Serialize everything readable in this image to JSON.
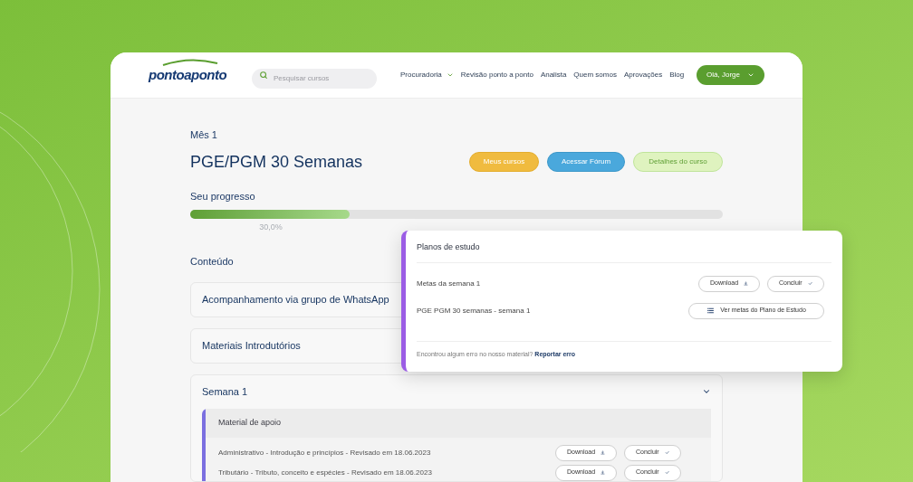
{
  "header": {
    "logo": "pontoaponto",
    "search": {
      "placeholder": "Pesquisar cursos"
    },
    "nav": [
      {
        "label": "Procuradoria",
        "dropdown": true
      },
      {
        "label": "Revisão ponto a ponto",
        "dropdown": false
      },
      {
        "label": "Analista",
        "dropdown": false
      },
      {
        "label": "Quem somos",
        "dropdown": false
      },
      {
        "label": "Aprovações",
        "dropdown": false
      },
      {
        "label": "Blog",
        "dropdown": false
      }
    ],
    "user_button": "Olá, Jorge"
  },
  "course": {
    "month": "Mês 1",
    "title": "PGE/PGM 30 Semanas",
    "buttons": [
      {
        "label": "Meus cursos",
        "kind": "primary"
      },
      {
        "label": "Acessar Fórum",
        "kind": "info"
      },
      {
        "label": "Detalhes do curso",
        "kind": "secondary"
      }
    ]
  },
  "progress": {
    "label": "Seu progresso",
    "level": 0.3,
    "reading": "30,0%"
  },
  "content": {
    "heading": "Conteúdo",
    "sections": [
      {
        "title": "Acompanhamento via grupo de WhatsApp"
      },
      {
        "title": "Materiais Introdutórios"
      },
      {
        "title": "Semana 1",
        "expanded": true,
        "groups": [
          {
            "title": "Material de apoio",
            "items": [
              {
                "title": "Administrativo - Introdução e princípios - Revisado em 18.06.2023",
                "actions": [
                  {
                    "label": "Download",
                    "kind": "download"
                  },
                  {
                    "label": "Concluir",
                    "kind": "complete"
                  }
                ]
              },
              {
                "title": "Tributário - Tributo, conceito e espécies - Revisado em 18.06.2023",
                "actions": [
                  {
                    "label": "Download",
                    "kind": "download"
                  },
                  {
                    "label": "Concluir",
                    "kind": "complete"
                  }
                ]
              }
            ]
          }
        ]
      }
    ]
  },
  "study_plan_panel": {
    "title": "Planos de estudo",
    "items": [
      {
        "title": "Metas da semana 1",
        "actions": [
          {
            "label": "Download",
            "kind": "download"
          },
          {
            "label": "Concluir",
            "kind": "complete"
          }
        ]
      },
      {
        "title": "PGE PGM 30 semanas - semana 1",
        "actions": [
          {
            "label": "Ver metas do Plano de Estudo",
            "kind": "list"
          }
        ]
      }
    ],
    "footer": {
      "text": "Encontrou algum erro no nosso material?",
      "link": "Reportar erro"
    }
  }
}
